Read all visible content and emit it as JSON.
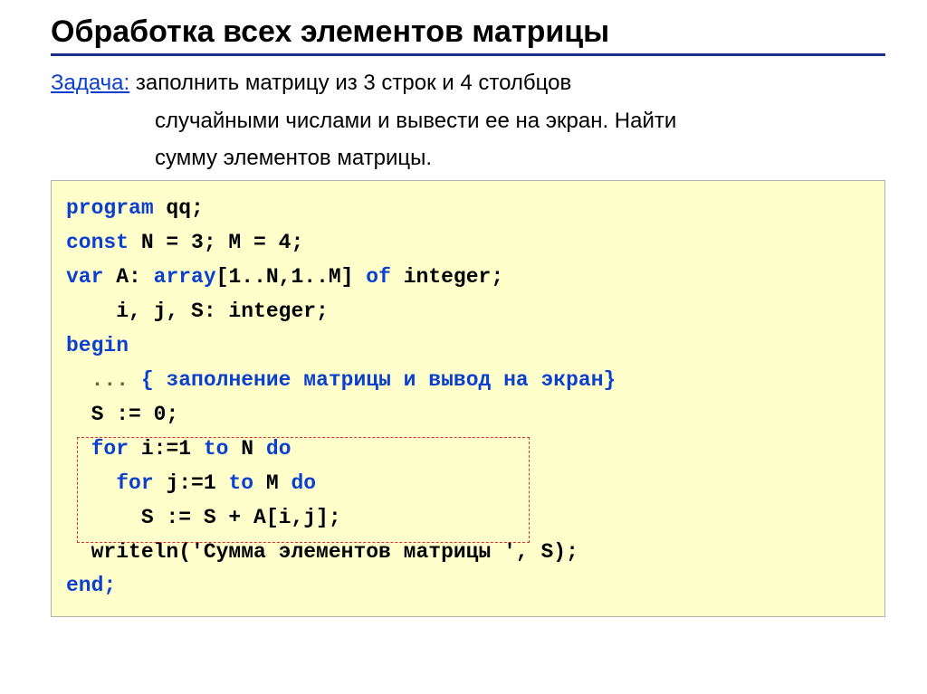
{
  "title": "Обработка всех элементов матрицы",
  "task": {
    "label": "Задача:",
    "line1": " заполнить матрицу из 3 строк и 4 столбцов",
    "line2": "случайными числами и вывести ее на экран. Найти",
    "line3": "сумму элементов матрицы."
  },
  "code": {
    "l1a": "program",
    "l1b": " qq;",
    "l2a": "const",
    "l2b": " N = 3; M = 4;",
    "l3a": "var",
    "l3b": " A: ",
    "l3c": "array",
    "l3d": "[1..N,1..M] ",
    "l3e": "of",
    "l3f": " integer;",
    "l4": "    i, j, S: integer;",
    "l5": "begin",
    "l6a": "  ",
    "l6b": "...",
    "l6c": " { заполнение матрицы и вывод на экран}",
    "l7": "  S := 0;",
    "l8a": "  ",
    "l8b": "for",
    "l8c": " i:=1 ",
    "l8d": "to",
    "l8e": " N ",
    "l8f": "do",
    "l9a": "    ",
    "l9b": "for",
    "l9c": " j:=1 ",
    "l9d": "to",
    "l9e": " M ",
    "l9f": "do",
    "l10": "      S := S + A[i,j];",
    "l11": "  writeln('Сумма элементов матрицы ', S);",
    "l12": "end;"
  }
}
